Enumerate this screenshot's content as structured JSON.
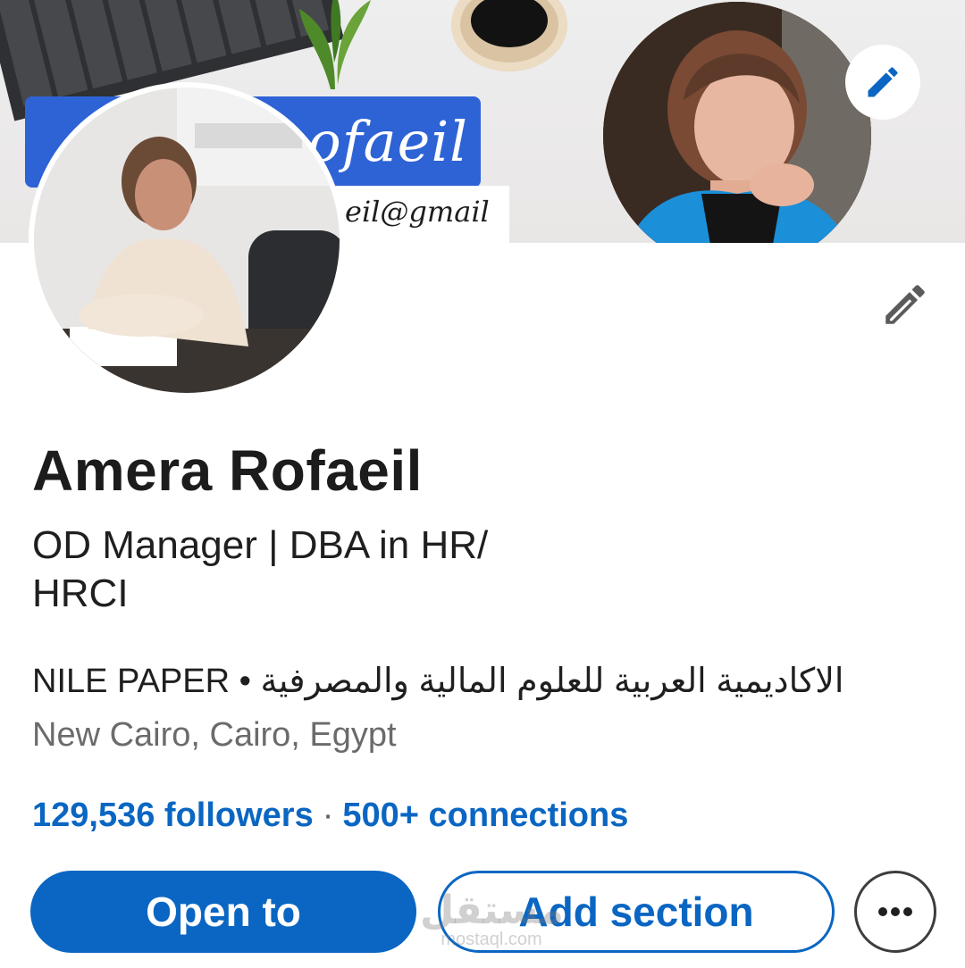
{
  "cover": {
    "banner_name": "Dr. Amera Rofaeil",
    "banner_name_visible": "ofaeil",
    "banner_email_visible": "eil@gmail"
  },
  "profile": {
    "name": "Amera Rofaeil",
    "headline_line1": "OD Manager | DBA in HR/",
    "headline_line2": "HRCI",
    "company": "NILE PAPER",
    "company_separator": "•",
    "education": "الاكاديمية العربية للعلوم المالية والمصرفية",
    "location": "New Cairo, Cairo, Egypt",
    "followers": "129,536 followers",
    "network_separator": "·",
    "connections": "500+ connections"
  },
  "actions": {
    "open_to_label": "Open to",
    "add_section_label": "Add section",
    "more_icon": "more-horizontal-icon"
  },
  "icons": {
    "cover_edit": "pencil-icon",
    "profile_edit": "pencil-icon"
  },
  "watermark": {
    "arabic": "مستقل",
    "latin": "mostaql.com"
  },
  "colors": {
    "accent": "#0a66c2",
    "banner_blue": "#2e63d6",
    "text_primary": "#1f1f1f",
    "text_secondary": "#6b6b6b"
  }
}
